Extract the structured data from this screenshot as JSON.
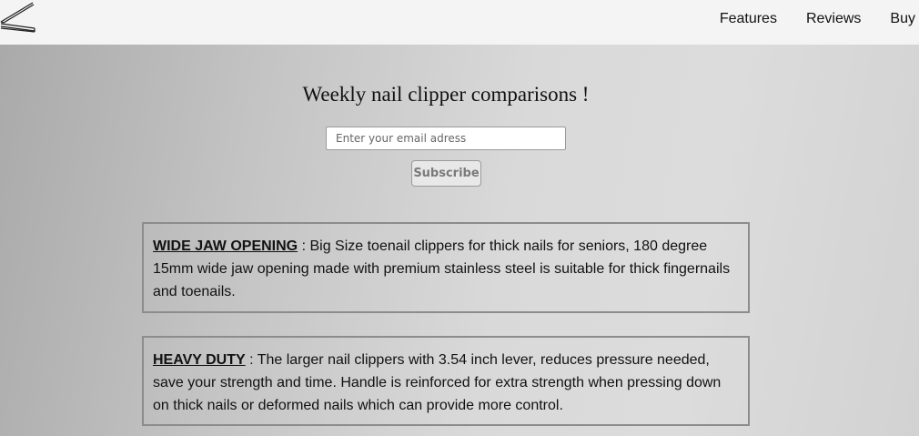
{
  "header": {
    "logo_icon": "nail-clipper-logo-icon",
    "nav": {
      "features": "Features",
      "reviews": "Reviews",
      "buy": "Buy"
    }
  },
  "newsletter": {
    "title": "Weekly nail clipper comparisons !",
    "email_placeholder": "Enter your email adress",
    "subscribe_label": "Subscribe"
  },
  "features": [
    {
      "title": "WIDE JAW OPENING",
      "separator": " : ",
      "text": "Big Size toenail clippers for thick nails for seniors, 180 degree 15mm wide jaw opening made with premium stainless steel is suitable for thick fingernails and toenails."
    },
    {
      "title": "HEAVY DUTY",
      "separator": " : ",
      "text": "The larger nail clippers with 3.54 inch lever, reduces pressure needed, save your strength and time. Handle is reinforced for extra strength when pressing down on thick nails or deformed nails which can provide more control."
    }
  ],
  "colors": {
    "header_bg": "#f4f4f4",
    "card_border": "#8c8c8c",
    "text": "#111111"
  }
}
